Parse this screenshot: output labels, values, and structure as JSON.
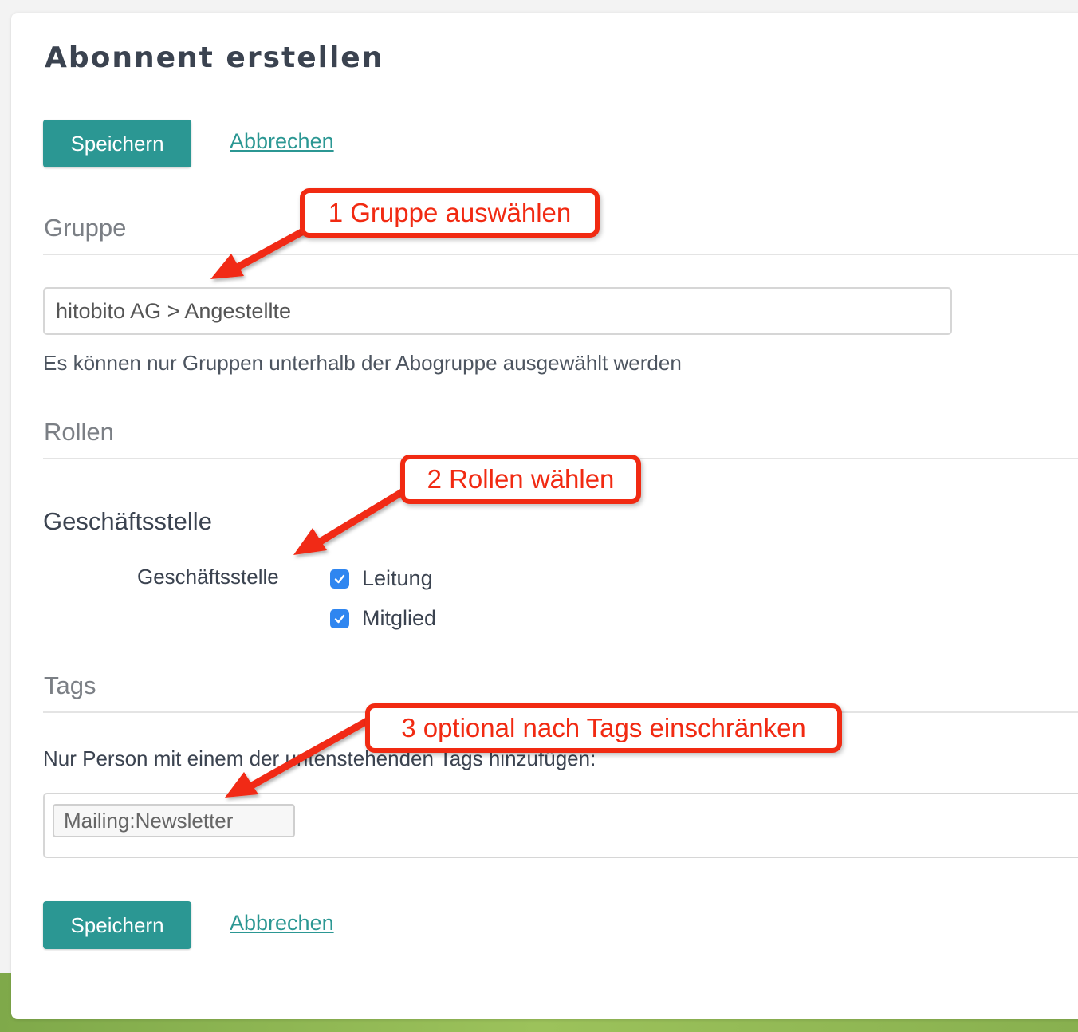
{
  "page": {
    "title": "Abonnent erstellen"
  },
  "actions_top": {
    "save_label": "Speichern",
    "cancel_label": "Abbrechen"
  },
  "group_section": {
    "heading": "Gruppe",
    "input_value": "hitobito AG > Angestellte",
    "help_text": "Es können nur Gruppen unterhalb der Abogruppe ausgewählt werden"
  },
  "roles_section": {
    "heading": "Rollen",
    "subgroup_title": "Geschäftsstelle",
    "group_label": "Geschäftsstelle",
    "roles": [
      {
        "label": "Leitung",
        "checked": true
      },
      {
        "label": "Mitglied",
        "checked": true
      }
    ]
  },
  "tags_section": {
    "heading": "Tags",
    "help_text": "Nur Person mit einem der untenstehenden Tags hinzufügen:",
    "tags": [
      "Mailing:Newsletter"
    ]
  },
  "actions_bottom": {
    "save_label": "Speichern",
    "cancel_label": "Abbrechen"
  },
  "annotations": {
    "step1": "1 Gruppe auswählen",
    "step2": "2 Rollen wählen",
    "step3": "3 optional nach Tags einschränken"
  },
  "colors": {
    "primary": "#2b9793",
    "annotation": "#f12a12",
    "checkbox": "#2f86f0"
  }
}
